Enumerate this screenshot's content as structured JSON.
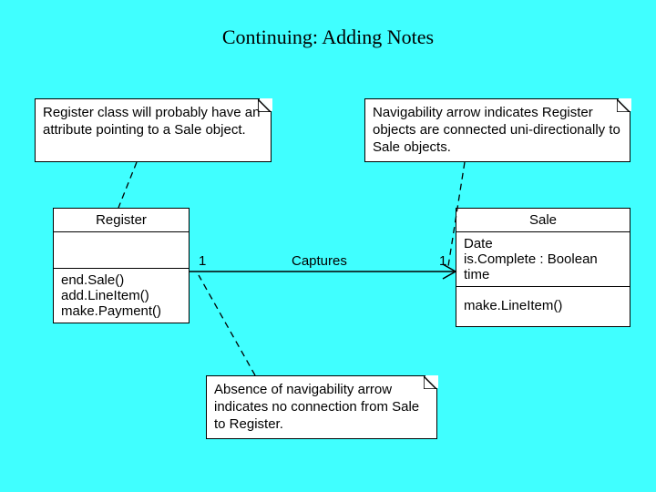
{
  "title": "Continuing:  Adding Notes",
  "notes": {
    "topLeft": "Register class will probably have an attribute pointing to a Sale object.",
    "topRight": "Navigability arrow indicates Register objects are connected uni-directionally to Sale objects.",
    "bottom": "Absence of navigability arrow indicates no connection from Sale to Register."
  },
  "classes": {
    "register": {
      "name": "Register",
      "ops": [
        "end.Sale()",
        "add.LineItem()",
        "make.Payment()"
      ]
    },
    "sale": {
      "name": "Sale",
      "attrs": [
        "Date",
        "is.Complete : Boolean",
        "time"
      ],
      "ops": [
        "make.LineItem()"
      ]
    }
  },
  "association": {
    "label": "Captures",
    "multLeft": "1",
    "multRight": "1"
  }
}
